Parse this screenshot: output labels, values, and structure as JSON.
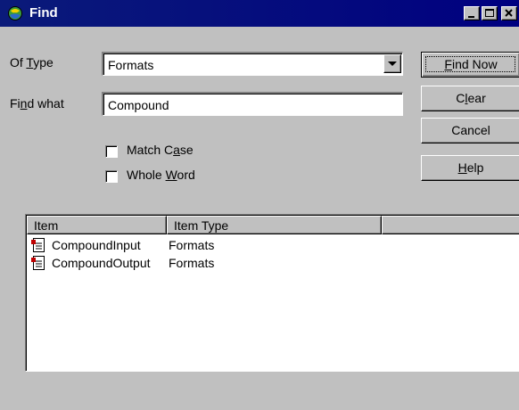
{
  "window": {
    "title": "Find",
    "controls": [
      "minimize-icon",
      "maximize-icon",
      "close-icon"
    ]
  },
  "form": {
    "of_type_label": "Of Type",
    "of_type_value": "Formats",
    "find_what_label": "Find what",
    "find_what_value": "Compound",
    "match_case_label": "Match Case",
    "match_case_checked": false,
    "whole_word_label": "Whole Word",
    "whole_word_checked": false
  },
  "buttons": {
    "find_now": "Find Now",
    "clear": "Clear",
    "cancel": "Cancel",
    "help": "Help"
  },
  "results": {
    "columns": [
      "Item",
      "Item Type",
      ""
    ],
    "rows": [
      {
        "item": "CompoundInput",
        "type": "Formats",
        "icon": "format-document-icon"
      },
      {
        "item": "CompoundOutput",
        "type": "Formats",
        "icon": "format-document-icon"
      }
    ]
  },
  "colors": {
    "titlebar": "#000080",
    "face": "#c0c0c0"
  }
}
